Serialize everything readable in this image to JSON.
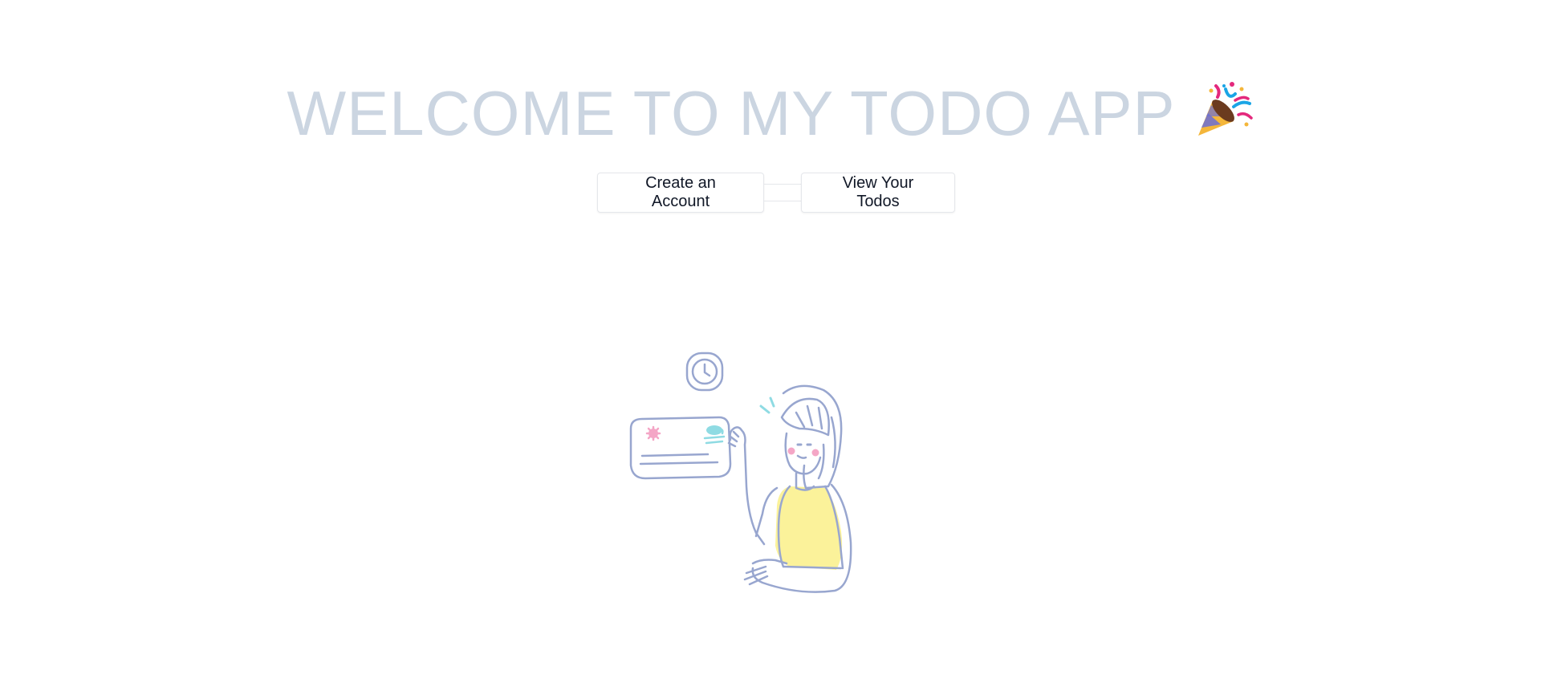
{
  "hero": {
    "title": "WELCOME TO MY TODO APP",
    "emoji_icon": "party-popper-icon"
  },
  "actions": {
    "create_account_label": "Create an Account",
    "view_todos_label": "View Your Todos"
  },
  "illustration": {
    "icon": "woman-holding-card-illustration"
  },
  "colors": {
    "title": "#cbd5e1",
    "button_text": "#111827",
    "button_border": "#e5e7eb",
    "illustration_line": "#98a6cf",
    "illustration_yellow": "#fbf29a",
    "illustration_pink": "#f4a6c6",
    "illustration_cyan": "#8fdbe3"
  }
}
